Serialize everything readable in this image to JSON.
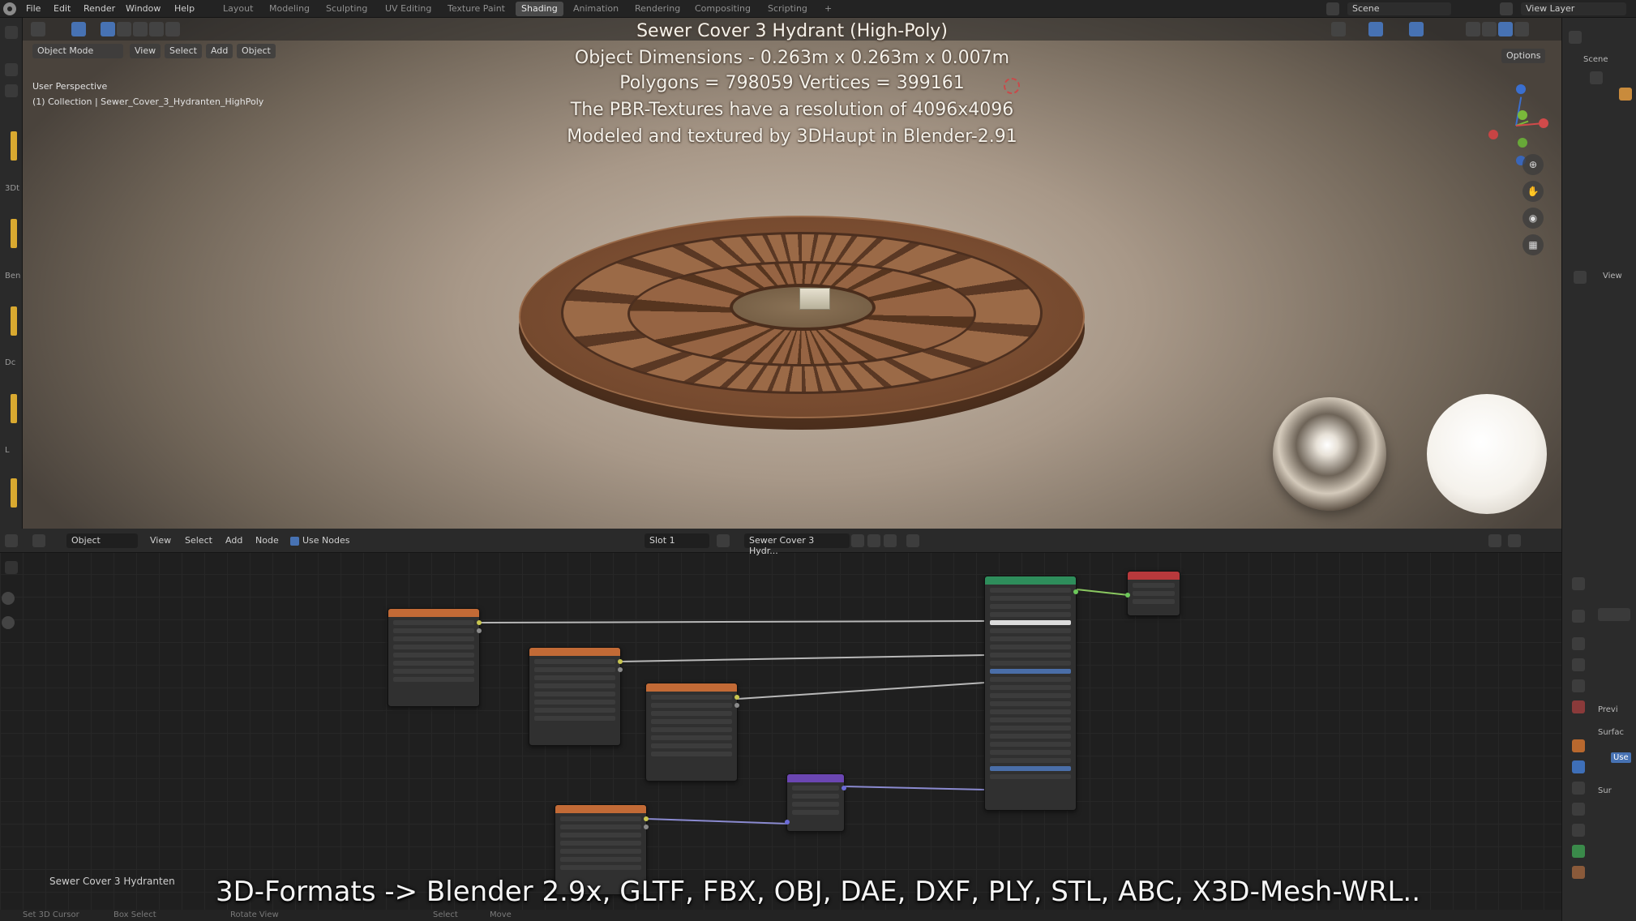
{
  "menu": [
    "File",
    "Edit",
    "Render",
    "Window",
    "Help"
  ],
  "workspaces": [
    {
      "label": "Layout",
      "active": false
    },
    {
      "label": "Modeling",
      "active": false
    },
    {
      "label": "Sculpting",
      "active": false
    },
    {
      "label": "UV Editing",
      "active": false
    },
    {
      "label": "Texture Paint",
      "active": false
    },
    {
      "label": "Shading",
      "active": true
    },
    {
      "label": "Animation",
      "active": false
    },
    {
      "label": "Rendering",
      "active": false
    },
    {
      "label": "Compositing",
      "active": false
    },
    {
      "label": "Scripting",
      "active": false
    }
  ],
  "add_workspace": "+",
  "scene_name": "Scene",
  "view_layer": "View Layer",
  "viewport": {
    "mode": "Object Mode",
    "menu": [
      "View",
      "Select",
      "Add",
      "Object"
    ],
    "options": "Options",
    "perspective": "User Perspective",
    "collection": "(1) Collection | Sewer_Cover_3_Hydranten_HighPoly"
  },
  "overlay": {
    "line1": "Sewer Cover 3 Hydrant (High-Poly)",
    "line2": "Object Dimensions - 0.263m x 0.263m x 0.007m",
    "line3": "Polygons = 798059  Vertices = 399161",
    "line4": "The PBR-Textures have a resolution of 4096x4096",
    "line5": "Modeled and textured by 3DHaupt in Blender-2.91"
  },
  "gizmo": {
    "z": "Z",
    "y": "Y",
    "x": "X"
  },
  "node_editor": {
    "object": "Object",
    "menu": [
      "View",
      "Select",
      "Add",
      "Node"
    ],
    "use_nodes": "Use Nodes",
    "slot": "Slot 1",
    "material": "Sewer Cover 3 Hydr...",
    "object_label": "Sewer Cover 3 Hydranten"
  },
  "right_panel": {
    "scene": "Scene",
    "view": "View",
    "preview": "Previ",
    "surface": "Surfac",
    "use": "Use",
    "sur": "Sur"
  },
  "left_labels": [
    "3Dt",
    "Ben",
    "Dc",
    "L"
  ],
  "banner": "3D-Formats -> Blender 2.9x, GLTF, FBX, OBJ, DAE, DXF, PLY, STL, ABC, X3D-Mesh-WRL..",
  "status": {
    "cursor": "Set 3D Cursor",
    "box_select": "Box Select",
    "rotate": "Rotate View",
    "select": "Select",
    "move": "Move"
  },
  "colors": {
    "active_tab": "#4a4a4a",
    "selection_blue": "#4772b3",
    "texture_node_header": "#c26a36",
    "principled_header": "#2e8d5b",
    "output_header": "#b8393c",
    "normal_map_header": "#6b46b2"
  }
}
